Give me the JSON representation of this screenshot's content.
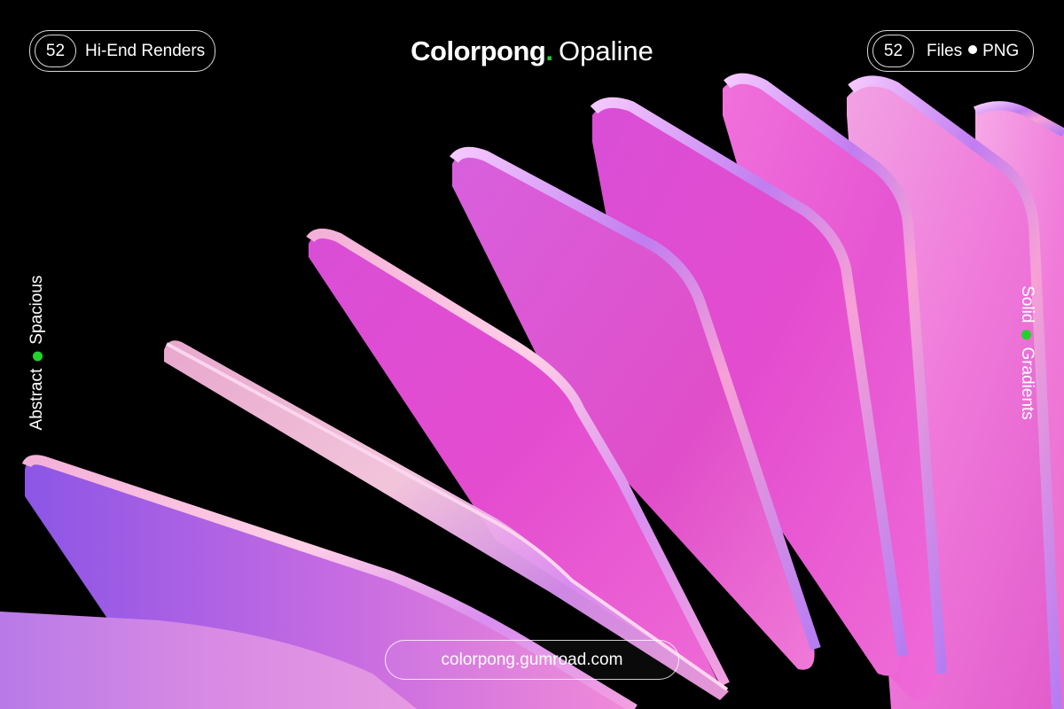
{
  "header": {
    "renders_count": "52",
    "renders_label": "Hi-End Renders",
    "brand": "Colorpong",
    "brand_dot": ".",
    "product": "Opaline",
    "files_count": "52",
    "files_label": "Files",
    "files_format": "PNG"
  },
  "side_left": {
    "word1": "Abstract",
    "word2": "Spacious"
  },
  "side_right": {
    "word1": "Solid",
    "word2": "Gradients"
  },
  "footer": {
    "url": "colorpong.gumroad.com"
  },
  "colors": {
    "background": "#000000",
    "text": "#ffffff",
    "accent_green": "#22d32a",
    "panel_pink": "#e94fd3",
    "panel_violet": "#b06ee8",
    "panel_light": "#f2a8e6"
  },
  "art": {
    "panel_count": 8,
    "description_icon": "glass-panel-fan"
  }
}
